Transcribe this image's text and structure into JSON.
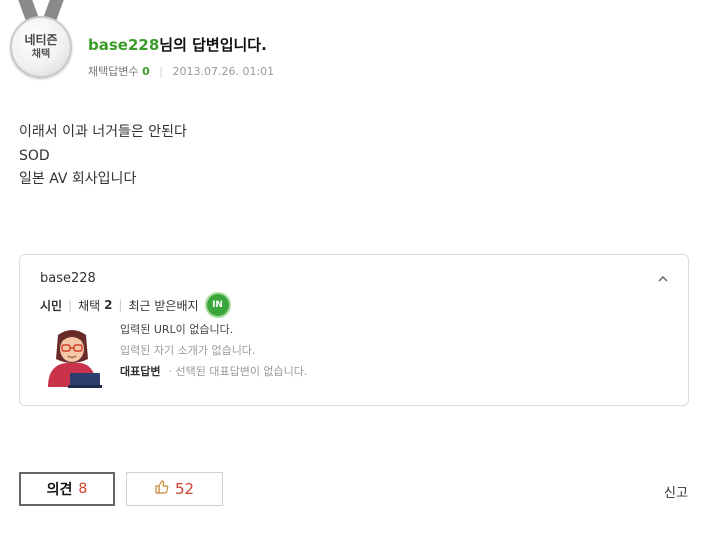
{
  "medal": {
    "line1": "네티즌",
    "line2": "채택"
  },
  "answer": {
    "username": "base228",
    "title_suffix": "님의 답변입니다.",
    "adopted_label": "채택답변수",
    "adopted_count": "0",
    "date": "2013.07.26.  01:01",
    "lines": [
      "이래서 이과 너거들은 안된다",
      "SOD",
      "일본 AV 회사입니다"
    ]
  },
  "profile": {
    "name": "base228",
    "collapse_icon": "chevron-up-icon",
    "level": "시민",
    "adopt_label": "채택",
    "adopt_count": "2",
    "badge_label": "최근 받은배지",
    "badge_text": "IN",
    "url_text": "입력된 URL이 없습니다.",
    "intro_text": "입력된 자기 소개가 없습니다.",
    "rep_label": "대표답변",
    "rep_value": "· 선택된 대표답변이 없습니다."
  },
  "actions": {
    "opinion_label": "의견",
    "opinion_count": "8",
    "like_icon": "thumbs-up-icon",
    "like_count": "52",
    "report_label": "신고"
  },
  "colors": {
    "accent_green": "#3b9c2a",
    "count_red": "#d0402c"
  }
}
